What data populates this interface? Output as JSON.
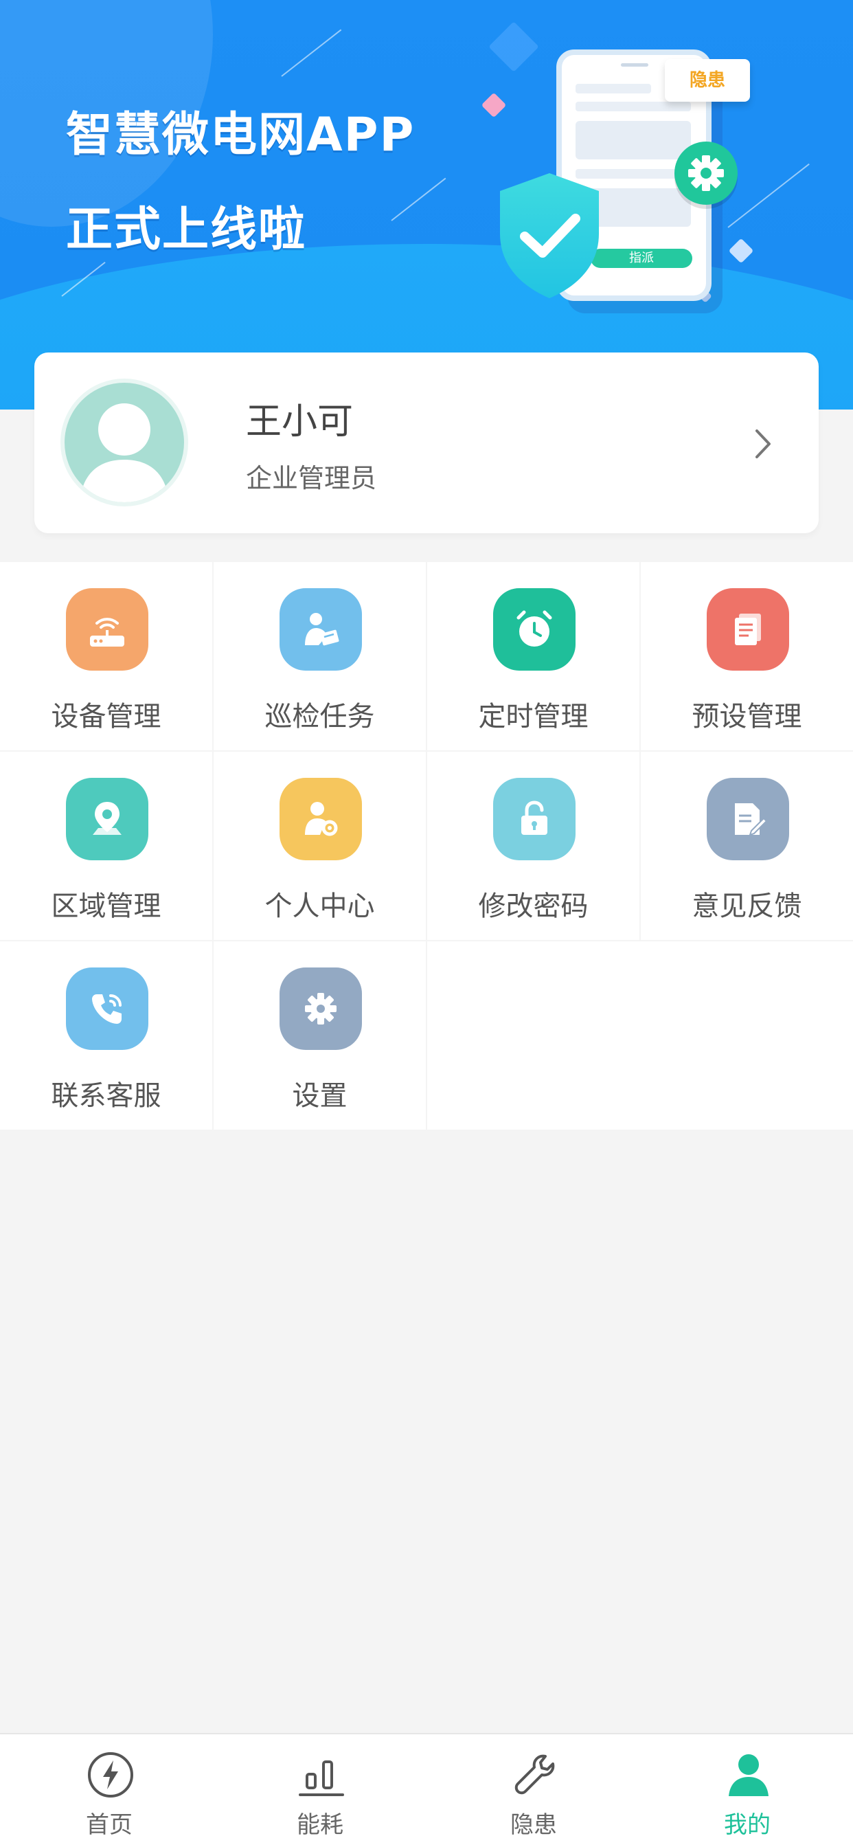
{
  "banner": {
    "line1": "智慧微电网APP",
    "line2": "正式上线啦",
    "illustration": {
      "tag_text": "隐患",
      "assign_text": "指派"
    }
  },
  "profile": {
    "name": "王小可",
    "role": "企业管理员"
  },
  "menu": [
    {
      "label": "设备管理",
      "icon": "router-icon",
      "color": "#f5a66b"
    },
    {
      "label": "巡检任务",
      "icon": "inspector-icon",
      "color": "#72bfec"
    },
    {
      "label": "定时管理",
      "icon": "alarm-clock-icon",
      "color": "#1fbf9a"
    },
    {
      "label": "预设管理",
      "icon": "document-stack-icon",
      "color": "#ee7368"
    },
    {
      "label": "区域管理",
      "icon": "location-pin-icon",
      "color": "#4ecabd"
    },
    {
      "label": "个人中心",
      "icon": "user-settings-icon",
      "color": "#f6c65d"
    },
    {
      "label": "修改密码",
      "icon": "unlock-icon",
      "color": "#7bd0e0"
    },
    {
      "label": "意见反馈",
      "icon": "edit-document-icon",
      "color": "#93a9c3"
    },
    {
      "label": "联系客服",
      "icon": "phone-call-icon",
      "color": "#72bfec"
    },
    {
      "label": "设置",
      "icon": "gear-icon",
      "color": "#93a9c3"
    }
  ],
  "tabs": [
    {
      "label": "首页",
      "icon": "lightning-icon",
      "active": false
    },
    {
      "label": "能耗",
      "icon": "bar-chart-icon",
      "active": false
    },
    {
      "label": "隐患",
      "icon": "wrench-icon",
      "active": false
    },
    {
      "label": "我的",
      "icon": "person-icon",
      "active": true
    }
  ],
  "colors": {
    "banner_blue": "#1d8ff5",
    "active_tab": "#1ec19a",
    "inactive_tab": "#666666"
  }
}
